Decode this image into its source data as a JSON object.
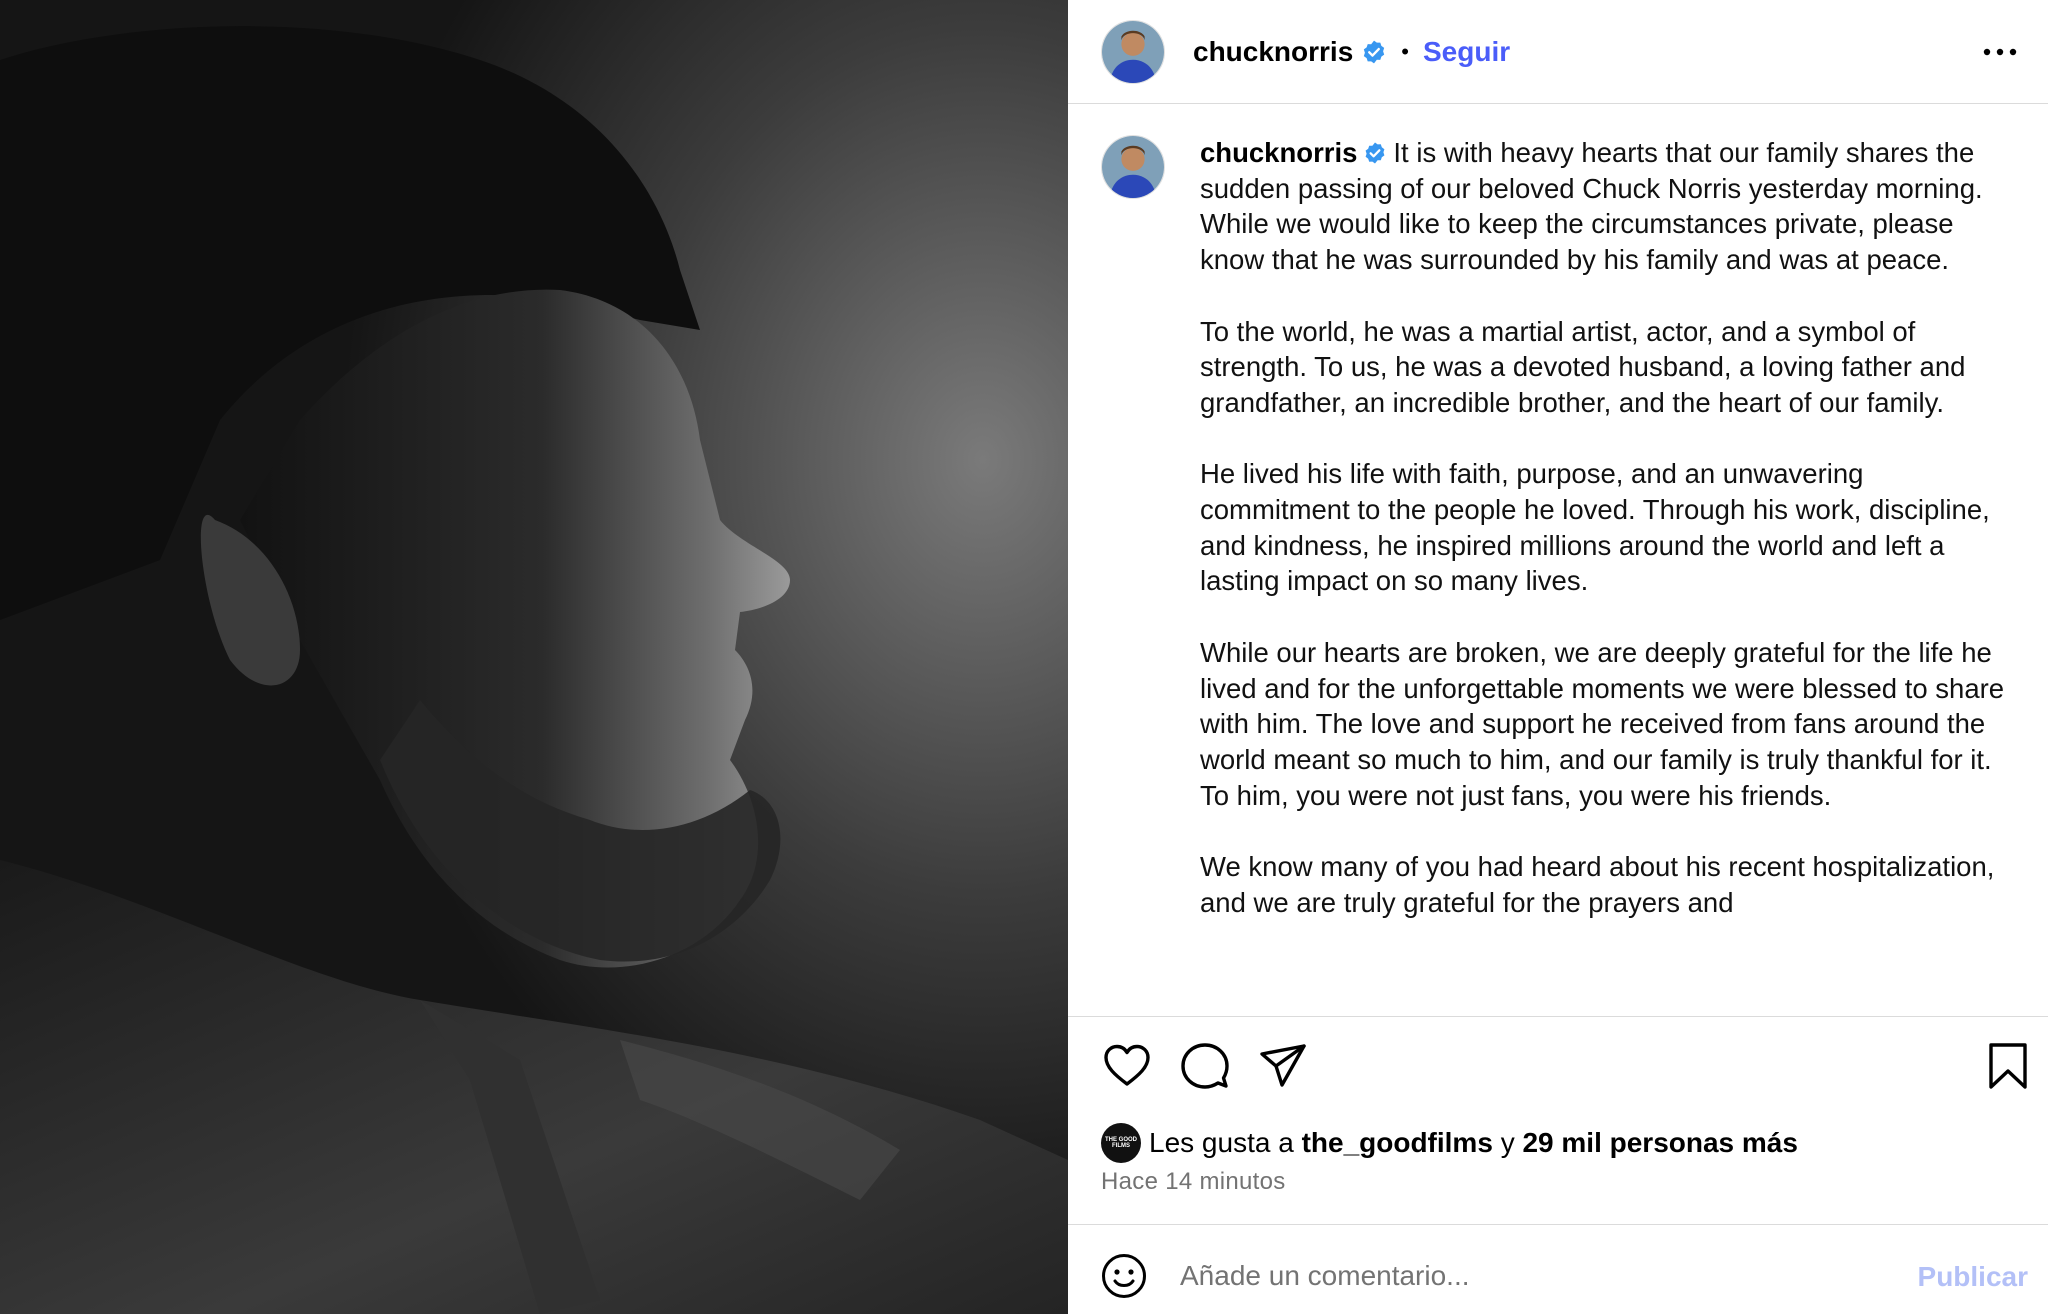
{
  "header": {
    "username": "chucknorris",
    "separator": "•",
    "follow_label": "Seguir"
  },
  "caption": {
    "username": "chucknorris",
    "paragraphs": [
      "It is with heavy hearts that our family shares the sudden passing of our beloved Chuck Norris yesterday morning. While we would like to keep the circumstances private, please know that he was surrounded by his family and was at peace.",
      "To the world, he was a martial artist, actor, and a symbol of strength. To us, he was a devoted husband, a loving father and grandfather, an incredible brother, and the heart of our family.",
      "He lived his life with faith, purpose, and an unwavering commitment to the people he loved. Through his work, discipline, and kindness, he inspired millions around the world and left a lasting impact on so many lives.",
      "While our hearts are broken, we are deeply grateful for the life he lived and for the unforgettable moments we were blessed to share with him. The love and support he received from fans around the world meant so much to him, and our family is truly thankful for it. To him, you were not just fans, you were his friends.",
      "We know many of you had heard about his recent hospitalization, and we are truly grateful for the prayers and"
    ]
  },
  "likes": {
    "prefix": "Les gusta a",
    "liker": "the_goodfilms",
    "conjunction": "y",
    "others": "29 mil personas más",
    "liker_avatar_text": "THE GOOD FILMS"
  },
  "timestamp": "Hace 14 minutos",
  "comment": {
    "placeholder": "Añade un comentario...",
    "publish_label": "Publicar"
  },
  "colors": {
    "accent": "#4a5df9",
    "verified": "#3897f0",
    "publish_disabled": "#b3c0f7",
    "muted": "#737373"
  },
  "icons": [
    "verified-badge-icon",
    "more-options-icon",
    "heart-icon",
    "comment-icon",
    "share-icon",
    "bookmark-icon",
    "emoji-icon"
  ]
}
